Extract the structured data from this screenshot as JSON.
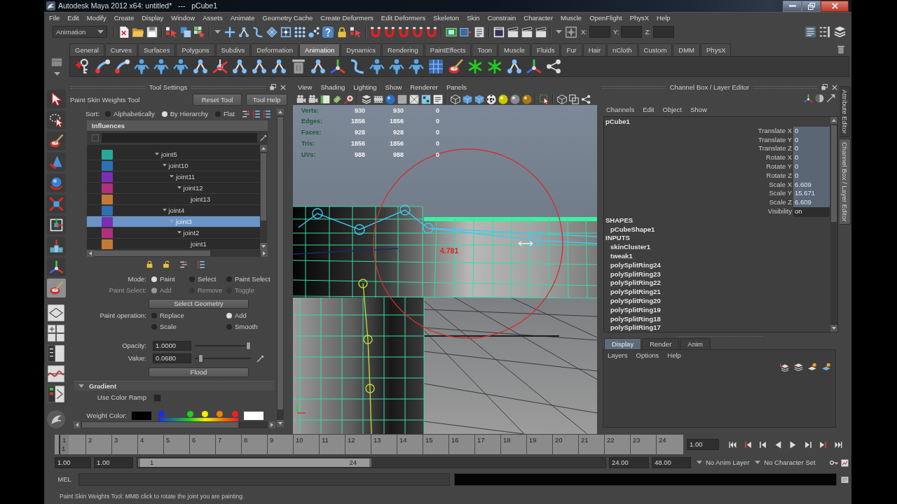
{
  "window": {
    "title": "Autodesk Maya 2012 x64: untitled*   ---   pCube1"
  },
  "menu_bar": [
    "File",
    "Edit",
    "Modify",
    "Create",
    "Display",
    "Window",
    "Assets",
    "Animate",
    "Geometry Cache",
    "Create Deformers",
    "Edit Deformers",
    "Skeleton",
    "Skin",
    "Constrain",
    "Character",
    "Muscle",
    "OpenFlight",
    "PhysX",
    "Help"
  ],
  "status_line": {
    "menu_set": "Animation",
    "coordinate_labels": [
      "X:",
      "Y:",
      "Z:"
    ]
  },
  "shelf": {
    "tabs": [
      {
        "label": "General",
        "selected": false
      },
      {
        "label": "Curves",
        "selected": false
      },
      {
        "label": "Surfaces",
        "selected": false
      },
      {
        "label": "Polygons",
        "selected": false
      },
      {
        "label": "Subdivs",
        "selected": false
      },
      {
        "label": "Deformation",
        "selected": false
      },
      {
        "label": "Animation",
        "selected": true
      },
      {
        "label": "Dynamics",
        "selected": false
      },
      {
        "label": "Rendering",
        "selected": false
      },
      {
        "label": "PaintEffects",
        "selected": false
      },
      {
        "label": "Toon",
        "selected": false
      },
      {
        "label": "Muscle",
        "selected": false
      },
      {
        "label": "Fluids",
        "selected": false
      },
      {
        "label": "Fur",
        "selected": false
      },
      {
        "label": "Hair",
        "selected": false
      },
      {
        "label": "nCloth",
        "selected": false
      },
      {
        "label": "Custom",
        "selected": false
      },
      {
        "label": "DMM",
        "selected": false
      },
      {
        "label": "PhysX",
        "selected": false
      }
    ]
  },
  "toolbox": {
    "tools": [
      {
        "selected": false
      },
      {
        "selected": false
      },
      {
        "selected": false
      },
      {
        "selected": false
      },
      {
        "selected": false
      },
      {
        "selected": false
      },
      {
        "selected": false
      },
      {
        "selected": false
      },
      {
        "selected": false
      },
      {
        "selected": true
      }
    ]
  },
  "tool_settings": {
    "title": "Tool Settings",
    "tool_name": "Paint Skin Weights Tool",
    "buttons": [
      "Reset Tool",
      "Tool Help"
    ],
    "sort": {
      "label": "Sort:",
      "options": [
        {
          "label": "Alphabetically",
          "selected": false
        },
        {
          "label": "By Hierarchy",
          "selected": true
        },
        {
          "label": "Flat",
          "selected": false
        }
      ]
    },
    "influences": {
      "title": "Influences",
      "items": [
        {
          "label": "joint5",
          "color": "#2aa79c",
          "expanded": true,
          "selected": false,
          "children": [
            {
              "label": "joint10",
              "color": "#2f6fb4",
              "expanded": true,
              "selected": false,
              "children": [
                {
                  "label": "joint11",
                  "color": "#7b2fb4",
                  "expanded": true,
                  "selected": false,
                  "children": [
                    {
                      "label": "joint12",
                      "color": "#b0307e",
                      "expanded": true,
                      "selected": false,
                      "children": [
                        {
                          "label": "joint13",
                          "color": "#c27a34",
                          "expanded": false,
                          "selected": false
                        }
                      ]
                    }
                  ]
                }
              ]
            },
            {
              "label": "joint4",
              "color": "#2f6fb4",
              "expanded": true,
              "selected": false,
              "children": [
                {
                  "label": "joint3",
                  "color": "#7b2fb4",
                  "expanded": true,
                  "selected": true,
                  "children": [
                    {
                      "label": "joint2",
                      "color": "#b0307e",
                      "expanded": true,
                      "selected": false,
                      "children": [
                        {
                          "label": "joint1",
                          "color": "#c27a34",
                          "expanded": false,
                          "selected": false
                        }
                      ]
                    }
                  ]
                }
              ]
            }
          ]
        }
      ]
    },
    "mode": {
      "label": "Mode:",
      "options": [
        {
          "label": "Paint",
          "selected": true
        },
        {
          "label": "Select",
          "selected": false
        },
        {
          "label": "Paint Select",
          "selected": false
        }
      ]
    },
    "paint_select": {
      "label": "Paint Select:",
      "disabled": true,
      "options": [
        {
          "label": "Add",
          "selected": true
        },
        {
          "label": "Remove",
          "selected": false
        },
        {
          "label": "Toggle",
          "selected": false
        }
      ]
    },
    "select_geometry_button": "Select Geometry",
    "paint_operation": {
      "label": "Paint operation:",
      "options": [
        {
          "label": "Replace",
          "selected": false
        },
        {
          "label": "Add",
          "selected": true
        },
        {
          "label": "Scale",
          "selected": false
        },
        {
          "label": "Smooth",
          "selected": false
        }
      ]
    },
    "opacity": {
      "label": "Opacity:",
      "value": "1.0000",
      "level": 1
    },
    "value": {
      "label": "Value:",
      "value": "0.0680",
      "level": 0.068
    },
    "flood_button": "Flood",
    "gradient": {
      "title": "Gradient",
      "expanded": true,
      "use_color_ramp": {
        "label": "Use Color Ramp",
        "checked": false
      },
      "weight_color_label": "Weight Color:",
      "end_swatches": [
        {
          "color": "#000000"
        },
        {
          "color": "#ffffff"
        }
      ],
      "ramp_markers": [
        {
          "color": "#1a2ee8",
          "level": 0
        },
        {
          "color": "#22cc22",
          "level": 0.39
        },
        {
          "color": "#f0f000",
          "level": 0.59
        },
        {
          "color": "#f08000",
          "level": 0.79
        },
        {
          "color": "#f02020",
          "level": 1
        }
      ]
    }
  },
  "viewport": {
    "menu": [
      "View",
      "Shading",
      "Lighting",
      "Show",
      "Renderer",
      "Panels"
    ],
    "hud": [
      {
        "label": "Verts:",
        "values": [
          "930",
          "930",
          "0"
        ]
      },
      {
        "label": "Edges:",
        "values": [
          "1856",
          "1856",
          "0"
        ]
      },
      {
        "label": "Faces:",
        "values": [
          "928",
          "928",
          "0"
        ]
      },
      {
        "label": "Tris:",
        "values": [
          "1856",
          "1856",
          "0"
        ]
      },
      {
        "label": "UVs:",
        "values": [
          "988",
          "988",
          "0"
        ]
      }
    ],
    "brush_readout": "4.781"
  },
  "channel_box": {
    "title": "Channel Box / Layer Editor",
    "menu": [
      "Channels",
      "Edit",
      "Object",
      "Show"
    ],
    "object": "pCube1",
    "channels": [
      {
        "name": "Translate X",
        "value": "0",
        "kind": "number"
      },
      {
        "name": "Translate Y",
        "value": "0",
        "kind": "number"
      },
      {
        "name": "Translate Z",
        "value": "0",
        "kind": "number"
      },
      {
        "name": "Rotate X",
        "value": "0",
        "kind": "number"
      },
      {
        "name": "Rotate Y",
        "value": "0",
        "kind": "number"
      },
      {
        "name": "Rotate Z",
        "value": "0",
        "kind": "number"
      },
      {
        "name": "Scale X",
        "value": "6.609",
        "kind": "number"
      },
      {
        "name": "Scale Y",
        "value": "15.671",
        "kind": "number"
      },
      {
        "name": "Scale Z",
        "value": "6.609",
        "kind": "number"
      },
      {
        "name": "Visibility",
        "value": "on",
        "kind": "boolean"
      }
    ],
    "shapes_header": "SHAPES",
    "shapes": [
      "pCubeShape1"
    ],
    "inputs_header": "INPUTS",
    "inputs": [
      "skinCluster1",
      "tweak1",
      "polySplitRing24",
      "polySplitRing23",
      "polySplitRing22",
      "polySplitRing21",
      "polySplitRing20",
      "polySplitRing19",
      "polySplitRing18",
      "polySplitRing17"
    ]
  },
  "layer_editor": {
    "tabs": [
      {
        "label": "Display",
        "selected": true
      },
      {
        "label": "Render",
        "selected": false
      },
      {
        "label": "Anim",
        "selected": false
      }
    ],
    "menu": [
      "Layers",
      "Options",
      "Help"
    ]
  },
  "side_tabs": [
    {
      "label": "Attribute Editor",
      "selected": false
    },
    {
      "label": "Channel Box / Layer Editor",
      "selected": true
    }
  ],
  "timeline": {
    "frames": [
      "1",
      "2",
      "3",
      "4",
      "5",
      "6",
      "7",
      "8",
      "9",
      "10",
      "11",
      "12",
      "13",
      "14",
      "15",
      "16",
      "17",
      "18",
      "19",
      "20",
      "21",
      "22",
      "23",
      "24"
    ],
    "level": 0,
    "current_frame": "1",
    "current_time": "1.00"
  },
  "range_slider": {
    "start_time": "1.00",
    "playback_start": "1.00",
    "range_start": "1",
    "range_end": "24",
    "level": 0.5,
    "playback_end": "24.00",
    "end_time": "48.00",
    "anim_layer": "No Anim Layer",
    "character_set": "No Character Set"
  },
  "command_line": {
    "language": "MEL"
  },
  "help_line": "Paint Skin Weights Tool: MMB click to rotate the joint you are painting."
}
